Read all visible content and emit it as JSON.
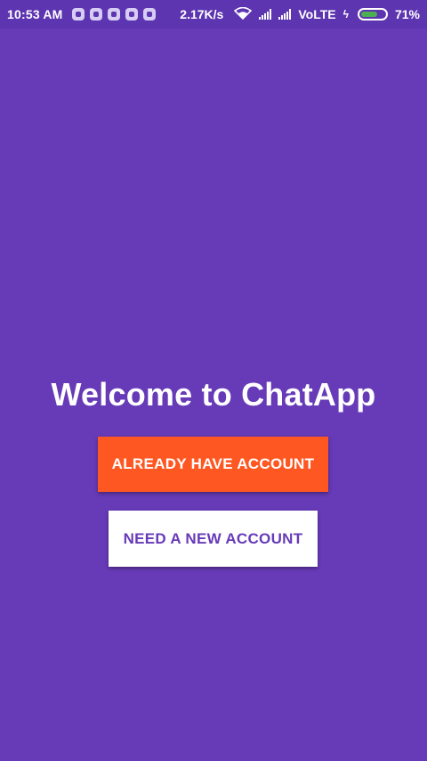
{
  "status_bar": {
    "time": "10:53 AM",
    "network_speed": "2.17K/s",
    "network_type": "VoLTE",
    "battery_percent": "71%",
    "battery_level": 0.71,
    "notification_icons": [
      "messenger-icon",
      "sim-icon",
      "phone-icon",
      "whatsapp-icon",
      "chat-icon"
    ],
    "battery_color": "#4caf50"
  },
  "main": {
    "title": "Welcome to ChatApp",
    "login_button_label": "ALREADY HAVE ACCOUNT",
    "register_button_label": "NEED A NEW ACCOUNT"
  },
  "colors": {
    "background": "#673ab7",
    "status_bar": "#5e35b1",
    "accent": "#ff5722",
    "primary_text_on_white": "#673ab7"
  }
}
